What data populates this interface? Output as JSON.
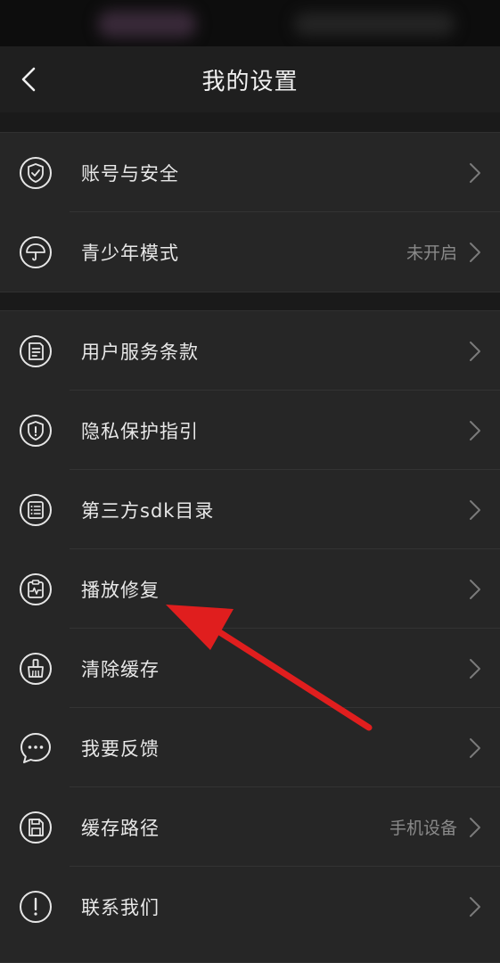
{
  "header": {
    "title": "我的设置",
    "back_icon": "chevron-left-icon"
  },
  "groups": [
    {
      "items": [
        {
          "label": "账号与安全",
          "value": "",
          "icon": "shield-check-icon"
        },
        {
          "label": "青少年模式",
          "value": "未开启",
          "icon": "umbrella-icon"
        }
      ]
    },
    {
      "items": [
        {
          "label": "用户服务条款",
          "value": "",
          "icon": "document-icon"
        },
        {
          "label": "隐私保护指引",
          "value": "",
          "icon": "privacy-shield-icon"
        },
        {
          "label": "第三方sdk目录",
          "value": "",
          "icon": "list-icon"
        },
        {
          "label": "播放修复",
          "value": "",
          "icon": "clipboard-pulse-icon"
        },
        {
          "label": "清除缓存",
          "value": "",
          "icon": "broom-icon"
        },
        {
          "label": "我要反馈",
          "value": "",
          "icon": "chat-bubble-icon"
        },
        {
          "label": "缓存路径",
          "value": "手机设备",
          "icon": "storage-card-icon"
        },
        {
          "label": "联系我们",
          "value": "",
          "icon": "exclamation-icon"
        }
      ]
    }
  ],
  "colors": {
    "background": "#1a1a1a",
    "row_background": "#262626",
    "annotation_arrow": "#e01e1e"
  }
}
